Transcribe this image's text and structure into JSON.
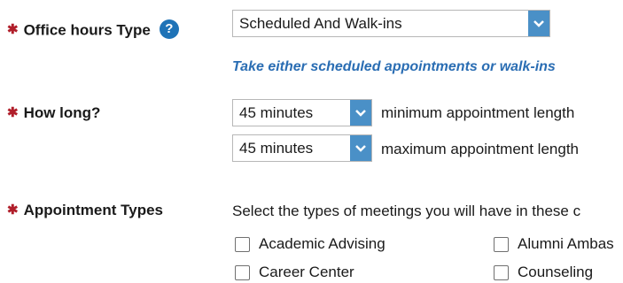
{
  "office_hours_type": {
    "label": "Office hours Type",
    "help_icon": "question-circle-icon",
    "selected": "Scheduled And Walk-ins",
    "hint": "Take either scheduled appointments or walk-ins"
  },
  "how_long": {
    "label": "How long?",
    "min_value": "45 minutes",
    "min_caption": "minimum appointment length",
    "max_value": "45 minutes",
    "max_caption": "maximum appointment length"
  },
  "appointment_types": {
    "label": "Appointment Types",
    "instruction": "Select the types of meetings you will have in these c",
    "options": [
      {
        "label": "Academic Advising",
        "checked": false
      },
      {
        "label": "Alumni Ambas",
        "checked": false
      },
      {
        "label": "Career Center",
        "checked": false
      },
      {
        "label": "Counseling",
        "checked": false
      }
    ]
  },
  "colors": {
    "required_star": "#b01e2a",
    "hint_text": "#2a6db3",
    "select_arrow_bg": "#4a90c7"
  }
}
